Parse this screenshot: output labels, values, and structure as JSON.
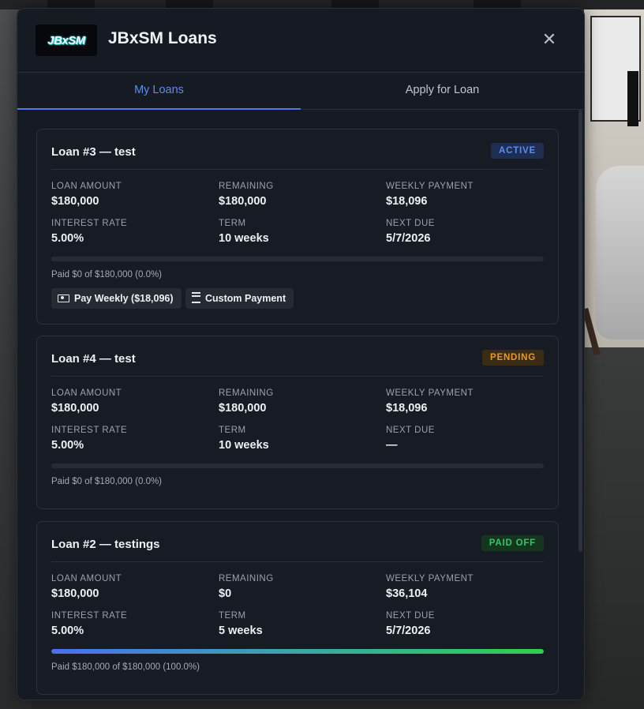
{
  "app": {
    "logo_text": "JBxSM",
    "title": "JBxSM Loans",
    "close_icon": "close-icon"
  },
  "tabs": [
    {
      "label": "My Loans",
      "active": true
    },
    {
      "label": "Apply for Loan",
      "active": false
    }
  ],
  "labels": {
    "loan_amount": "LOAN AMOUNT",
    "remaining": "REMAINING",
    "weekly_payment": "WEEKLY PAYMENT",
    "interest_rate": "INTEREST RATE",
    "term": "TERM",
    "next_due": "NEXT DUE"
  },
  "loans": [
    {
      "title": "Loan #3 — test",
      "status": "ACTIVE",
      "loan_amount": "$180,000",
      "remaining": "$180,000",
      "weekly_payment": "$18,096",
      "interest_rate": "5.00%",
      "term": "10 weeks",
      "next_due": "5/7/2026",
      "progress": 0.0,
      "paid_text": "Paid $0 of $180,000 (0.0%)",
      "actions": {
        "pay_weekly": "Pay Weekly ($18,096)",
        "custom_payment": "Custom Payment"
      }
    },
    {
      "title": "Loan #4 — test",
      "status": "PENDING",
      "loan_amount": "$180,000",
      "remaining": "$180,000",
      "weekly_payment": "$18,096",
      "interest_rate": "5.00%",
      "term": "10 weeks",
      "next_due": "—",
      "progress": 0.0,
      "paid_text": "Paid $0 of $180,000 (0.0%)"
    },
    {
      "title": "Loan #2 — testings",
      "status": "PAID OFF",
      "loan_amount": "$180,000",
      "remaining": "$0",
      "weekly_payment": "$36,104",
      "interest_rate": "5.00%",
      "term": "5 weeks",
      "next_due": "5/7/2026",
      "progress": 1.0,
      "paid_text": "Paid $180,000 of $180,000 (100.0%)"
    }
  ],
  "colors": {
    "accent": "#5b8def",
    "active": "#5b8cf0",
    "pending": "#e39a2a",
    "paid_off": "#35c46a"
  }
}
